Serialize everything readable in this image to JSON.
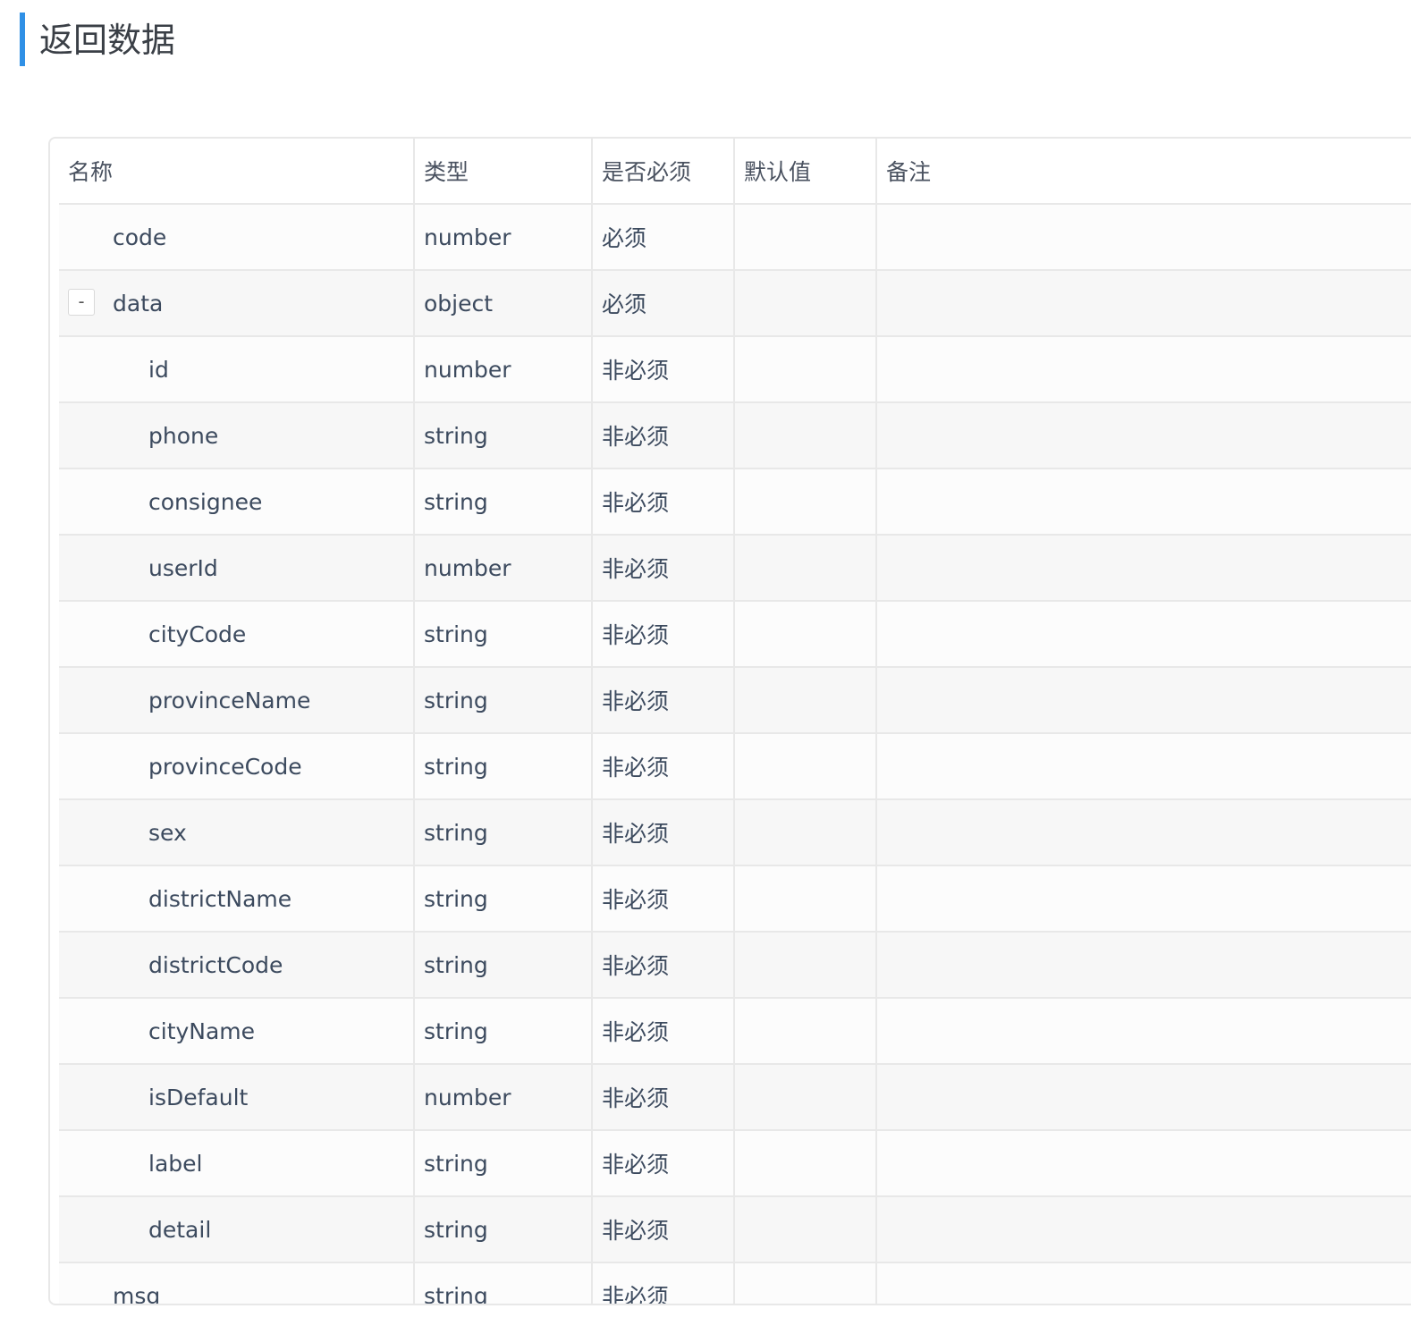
{
  "section": {
    "title": "返回数据"
  },
  "table": {
    "headers": {
      "name": "名称",
      "type": "类型",
      "required": "是否必须",
      "default": "默认值",
      "note": "备注"
    },
    "rows": [
      {
        "name": "code",
        "type": "number",
        "required": "必须",
        "default": "",
        "note": "",
        "level": 0,
        "expandable": false
      },
      {
        "name": "data",
        "type": "object",
        "required": "必须",
        "default": "",
        "note": "",
        "level": 0,
        "expandable": true,
        "toggle_symbol": "-"
      },
      {
        "name": "id",
        "type": "number",
        "required": "非必须",
        "default": "",
        "note": "",
        "level": 1,
        "expandable": false
      },
      {
        "name": "phone",
        "type": "string",
        "required": "非必须",
        "default": "",
        "note": "",
        "level": 1,
        "expandable": false
      },
      {
        "name": "consignee",
        "type": "string",
        "required": "非必须",
        "default": "",
        "note": "",
        "level": 1,
        "expandable": false
      },
      {
        "name": "userId",
        "type": "number",
        "required": "非必须",
        "default": "",
        "note": "",
        "level": 1,
        "expandable": false
      },
      {
        "name": "cityCode",
        "type": "string",
        "required": "非必须",
        "default": "",
        "note": "",
        "level": 1,
        "expandable": false
      },
      {
        "name": "provinceName",
        "type": "string",
        "required": "非必须",
        "default": "",
        "note": "",
        "level": 1,
        "expandable": false
      },
      {
        "name": "provinceCode",
        "type": "string",
        "required": "非必须",
        "default": "",
        "note": "",
        "level": 1,
        "expandable": false
      },
      {
        "name": "sex",
        "type": "string",
        "required": "非必须",
        "default": "",
        "note": "",
        "level": 1,
        "expandable": false
      },
      {
        "name": "districtName",
        "type": "string",
        "required": "非必须",
        "default": "",
        "note": "",
        "level": 1,
        "expandable": false
      },
      {
        "name": "districtCode",
        "type": "string",
        "required": "非必须",
        "default": "",
        "note": "",
        "level": 1,
        "expandable": false
      },
      {
        "name": "cityName",
        "type": "string",
        "required": "非必须",
        "default": "",
        "note": "",
        "level": 1,
        "expandable": false
      },
      {
        "name": "isDefault",
        "type": "number",
        "required": "非必须",
        "default": "",
        "note": "",
        "level": 1,
        "expandable": false
      },
      {
        "name": "label",
        "type": "string",
        "required": "非必须",
        "default": "",
        "note": "",
        "level": 1,
        "expandable": false
      },
      {
        "name": "detail",
        "type": "string",
        "required": "非必须",
        "default": "",
        "note": "",
        "level": 1,
        "expandable": false
      },
      {
        "name": "msg",
        "type": "string",
        "required": "非必须",
        "default": "",
        "note": "",
        "level": 0,
        "expandable": false
      }
    ]
  }
}
